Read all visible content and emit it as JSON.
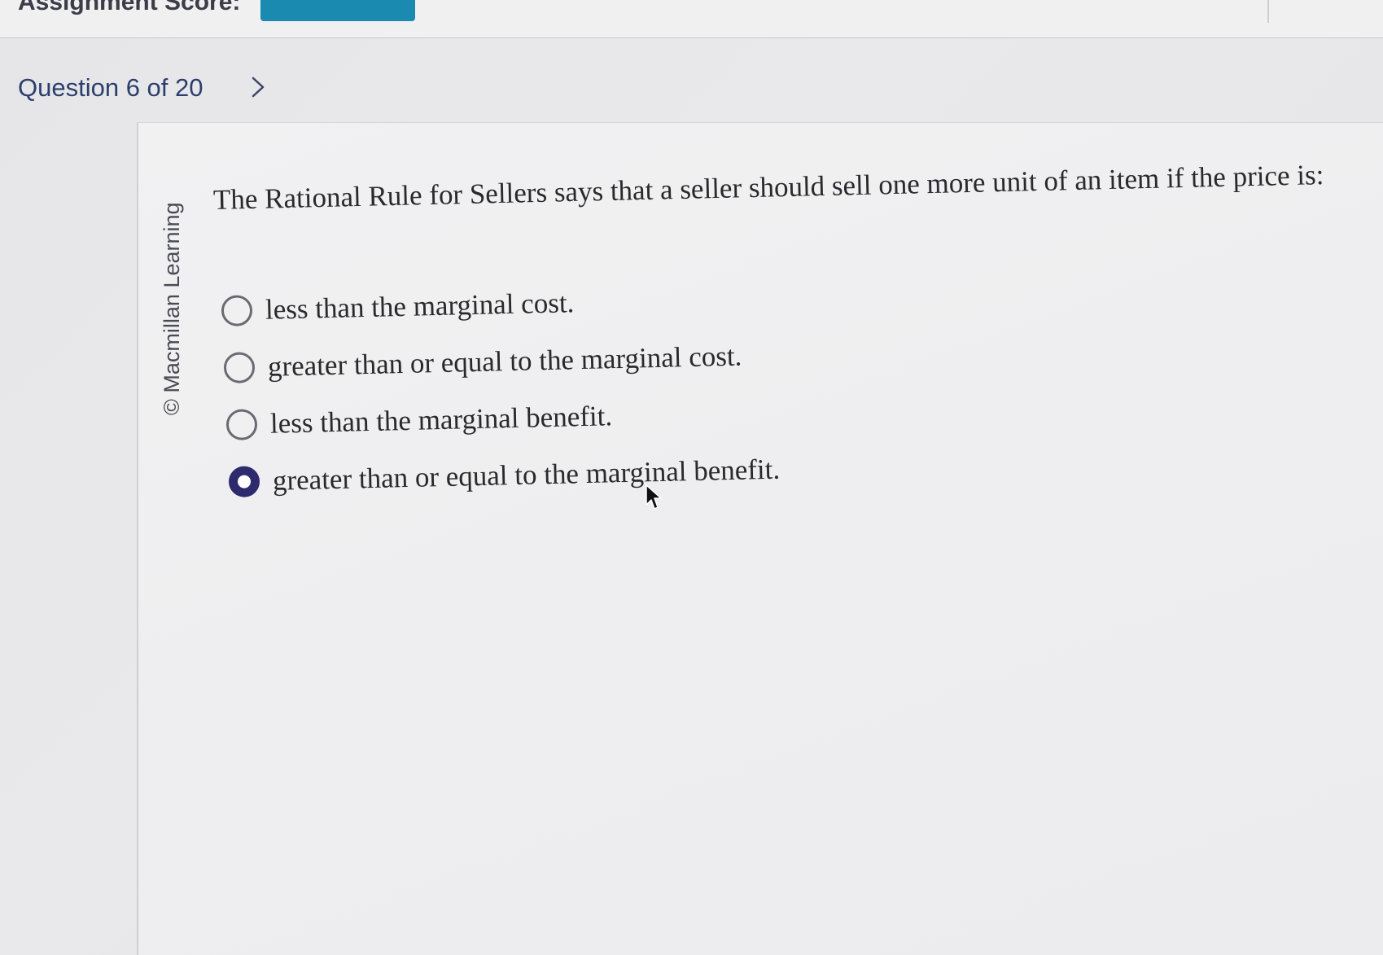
{
  "header": {
    "score_label": "Assignment Score:",
    "score_value": "",
    "question_label": "Question 6 of 20"
  },
  "sidebar": {
    "copyright": "© Macmillan Learning"
  },
  "question": {
    "prompt": "The Rational Rule for Sellers says that a seller should sell one more unit of an item if the price is:",
    "options": [
      {
        "label": "less than the marginal cost.",
        "selected": false
      },
      {
        "label": "greater than or equal to the marginal cost.",
        "selected": false
      },
      {
        "label": "less than the marginal benefit.",
        "selected": false
      },
      {
        "label": "greater than or equal to the marginal benefit.",
        "selected": true
      }
    ]
  },
  "colors": {
    "accent": "#2c3f6c",
    "selected_radio": "#2d2a6e",
    "score_button": "#1a8ab0"
  },
  "icons": {
    "next": "chevron-right-icon",
    "pointer": "mouse-pointer-icon"
  }
}
